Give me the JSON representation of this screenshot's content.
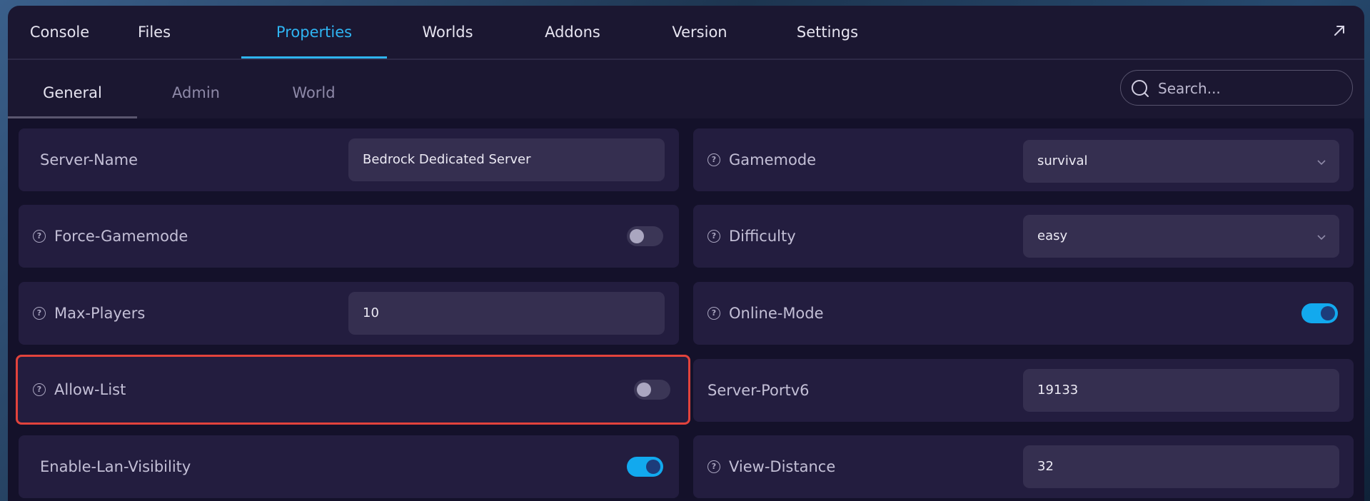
{
  "nav": {
    "tabs": [
      {
        "label": "Console"
      },
      {
        "label": "Files"
      },
      {
        "label": "Properties"
      },
      {
        "label": "Worlds"
      },
      {
        "label": "Addons"
      },
      {
        "label": "Version"
      },
      {
        "label": "Settings"
      }
    ],
    "active_tab": "Properties"
  },
  "subnav": {
    "tabs": [
      {
        "label": "General"
      },
      {
        "label": "Admin"
      },
      {
        "label": "World"
      }
    ],
    "active_tab": "General"
  },
  "search": {
    "placeholder": "Search...",
    "value": ""
  },
  "properties": {
    "server_name": {
      "label": "Server-Name",
      "value": "Bedrock Dedicated Server"
    },
    "gamemode": {
      "label": "Gamemode",
      "value": "survival"
    },
    "force_gamemode": {
      "label": "Force-Gamemode",
      "enabled": false
    },
    "difficulty": {
      "label": "Difficulty",
      "value": "easy"
    },
    "max_players": {
      "label": "Max-Players",
      "value": "10"
    },
    "online_mode": {
      "label": "Online-Mode",
      "enabled": true
    },
    "allow_list": {
      "label": "Allow-List",
      "enabled": false
    },
    "server_portv6": {
      "label": "Server-Portv6",
      "value": "19133"
    },
    "enable_lan_visibility": {
      "label": "Enable-Lan-Visibility",
      "enabled": true
    },
    "view_distance": {
      "label": "View-Distance",
      "value": "32"
    }
  },
  "help_glyph": "?",
  "colors": {
    "accent": "#2fb4f2",
    "highlight_border": "#e2433c",
    "toggle_on": "#12a9ee",
    "panel_bg": "#1b1731",
    "card_bg": "#231d3f"
  }
}
